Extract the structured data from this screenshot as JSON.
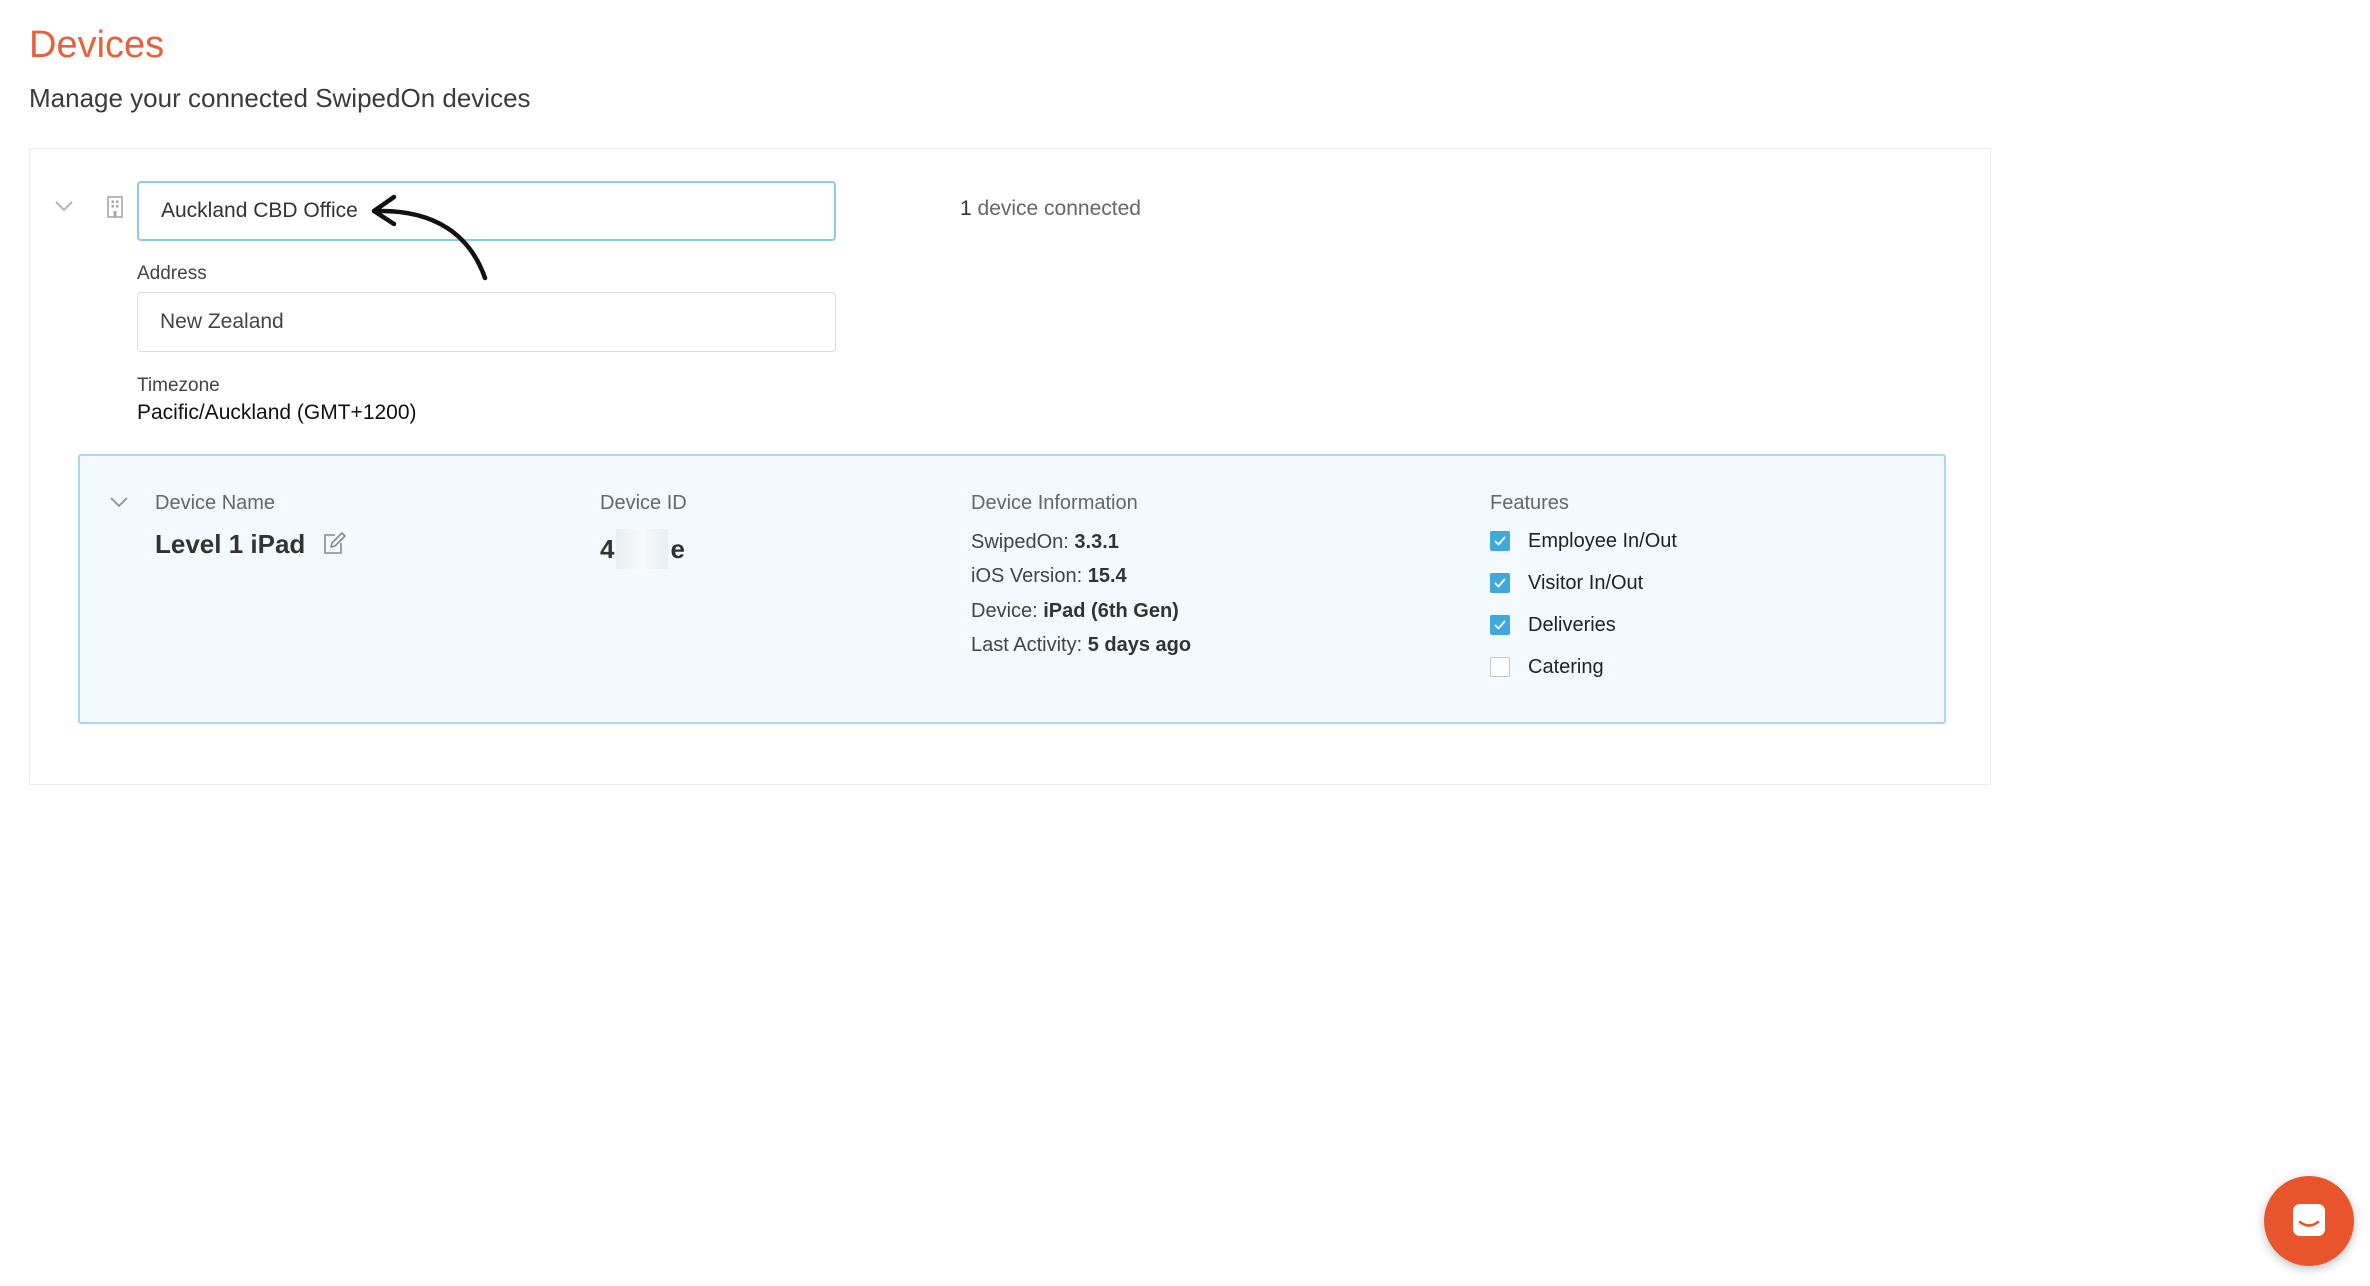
{
  "page": {
    "title": "Devices",
    "subtitle": "Manage your connected SwipedOn devices"
  },
  "location": {
    "name_value": "Auckland CBD Office",
    "device_count_number": "1",
    "device_count_text": " device connected",
    "address_label": "Address",
    "address_value": "New Zealand",
    "timezone_label": "Timezone",
    "timezone_value": "Pacific/Auckland (GMT+1200)"
  },
  "device": {
    "headers": {
      "name": "Device Name",
      "id": "Device ID",
      "info": "Device Information",
      "features": "Features"
    },
    "name": "Level 1 iPad",
    "id_start": "4",
    "id_end": "e",
    "info": [
      {
        "label": "SwipedOn: ",
        "value": "3.3.1"
      },
      {
        "label": "iOS Version: ",
        "value": "15.4"
      },
      {
        "label": "Device: ",
        "value": "iPad (6th Gen)"
      },
      {
        "label": "Last Activity: ",
        "value": "5 days ago"
      }
    ],
    "features": [
      {
        "label": "Employee In/Out",
        "checked": true
      },
      {
        "label": "Visitor In/Out",
        "checked": true
      },
      {
        "label": "Deliveries",
        "checked": true
      },
      {
        "label": "Catering",
        "checked": false
      }
    ]
  },
  "icons": {
    "location_toggle": "chevron-down-icon",
    "building": "building-icon",
    "edit": "pencil-edit-icon",
    "chat": "chat-icon",
    "annotation": "arrow-annotation-icon"
  },
  "colors": {
    "title": "#e8603c",
    "accent": "#3fa9db",
    "panel_bg": "#f3f9fc",
    "panel_border": "#a9d8ec",
    "chat": "#e8542c"
  }
}
